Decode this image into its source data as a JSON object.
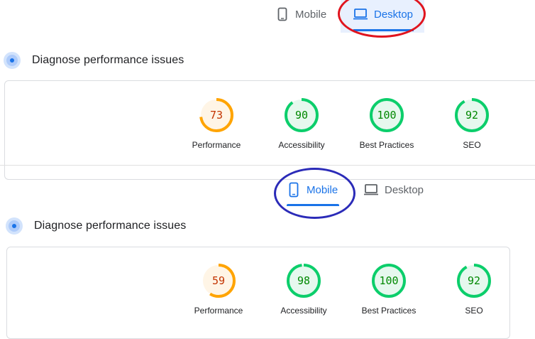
{
  "desktop_panel": {
    "tabs": [
      {
        "label": "Mobile",
        "icon": "phone-icon",
        "active": false
      },
      {
        "label": "Desktop",
        "icon": "laptop-icon",
        "active": true
      }
    ],
    "diagnose_title": "Diagnose performance issues",
    "scores": [
      {
        "label": "Performance",
        "value": "73",
        "fraction": 0.73,
        "status": "average"
      },
      {
        "label": "Accessibility",
        "value": "90",
        "fraction": 0.9,
        "status": "pass"
      },
      {
        "label": "Best Practices",
        "value": "100",
        "fraction": 1.0,
        "status": "pass"
      },
      {
        "label": "SEO",
        "value": "92",
        "fraction": 0.92,
        "status": "pass"
      }
    ],
    "annotation_color": "#e0141e"
  },
  "mobile_panel": {
    "tabs": [
      {
        "label": "Mobile",
        "icon": "phone-icon",
        "active": true
      },
      {
        "label": "Desktop",
        "icon": "laptop-icon",
        "active": false
      }
    ],
    "diagnose_title": "Diagnose performance issues",
    "scores": [
      {
        "label": "Performance",
        "value": "59",
        "fraction": 0.59,
        "status": "average"
      },
      {
        "label": "Accessibility",
        "value": "98",
        "fraction": 0.98,
        "status": "pass"
      },
      {
        "label": "Best Practices",
        "value": "100",
        "fraction": 1.0,
        "status": "pass"
      },
      {
        "label": "SEO",
        "value": "92",
        "fraction": 0.92,
        "status": "pass"
      }
    ],
    "annotation_color": "#2b2bb8"
  },
  "colors": {
    "accent": "#1a73e8",
    "pass": "#0cce6b",
    "pass_bg": "#e6f8ee",
    "pass_text": "#008800",
    "average": "#ffa400",
    "average_bg": "#fff5e6",
    "average_text": "#c33300"
  }
}
